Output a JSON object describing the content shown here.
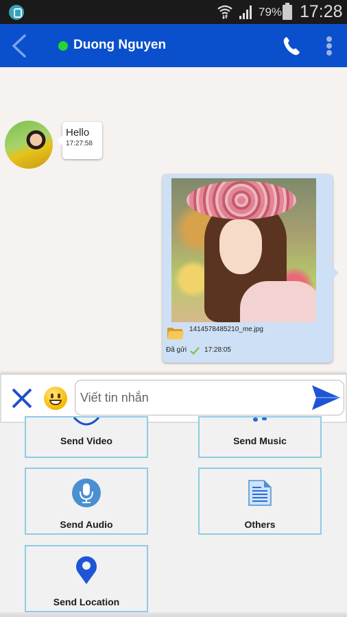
{
  "status_bar": {
    "app_icon": "chat-app-icon",
    "battery_percent": "79%",
    "time": "17:28"
  },
  "app_bar": {
    "back_icon": "chevron-left-icon",
    "contact_name": "Duong Nguyen",
    "presence": "online",
    "presence_color": "#22d633",
    "call_icon": "phone-icon",
    "more_icon": "more-vertical-icon",
    "bar_color": "#0a4fcc"
  },
  "messages": [
    {
      "direction": "incoming",
      "text": "Hello",
      "time": "17:27:58"
    },
    {
      "direction": "outgoing",
      "type": "image",
      "file_name": "1414578485210_me.jpg",
      "status": "Đã gửi",
      "time": "17:28:05"
    }
  ],
  "composer": {
    "placeholder": "Viết tin nhắn",
    "value": "",
    "close_icon": "close-icon",
    "emoji_icon": "emoji-icon",
    "send_icon": "send-icon"
  },
  "attach_panel": {
    "items": [
      {
        "label": "Send Video",
        "icon": "video-icon"
      },
      {
        "label": "Send Music",
        "icon": "music-icon"
      },
      {
        "label": "Send Audio",
        "icon": "microphone-icon"
      },
      {
        "label": "Others",
        "icon": "document-icon"
      },
      {
        "label": "Send Location",
        "icon": "location-pin-icon"
      }
    ]
  }
}
